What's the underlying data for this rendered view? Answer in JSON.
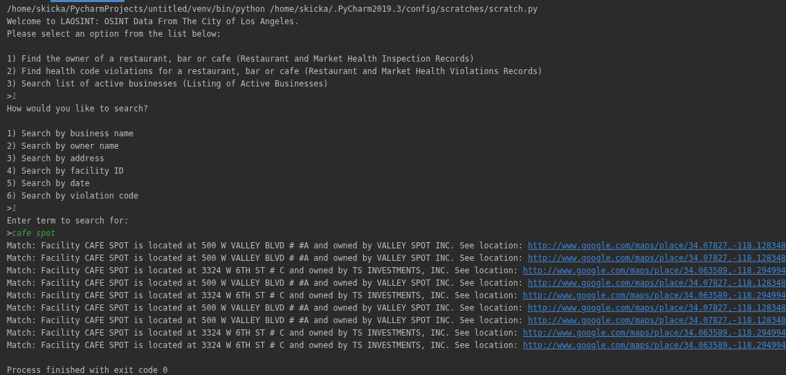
{
  "console": {
    "lines": [
      {
        "kind": "text",
        "text": "/home/skicka/PycharmProjects/untitled/venv/bin/python /home/skicka/.PyCharm2019.3/config/scratches/scratch.py"
      },
      {
        "kind": "text",
        "text": "Welcome to LAOSINT: OSINT Data From The City of Los Angeles."
      },
      {
        "kind": "text",
        "text": "Please select an option from the list below:"
      },
      {
        "kind": "blank"
      },
      {
        "kind": "text",
        "text": "1) Find the owner of a restaurant, bar or cafe (Restaurant and Market Health Inspection Records)"
      },
      {
        "kind": "text",
        "text": "2) Find health code violations for a restaurant, bar or cafe (Restaurant and Market Health Violations Records)"
      },
      {
        "kind": "text",
        "text": "3) Search list of active businesses (Listing of Active Businesses)"
      },
      {
        "kind": "input",
        "prompt": ">",
        "value": "1"
      },
      {
        "kind": "text",
        "text": "How would you like to search?"
      },
      {
        "kind": "blank"
      },
      {
        "kind": "text",
        "text": "1) Search by business name"
      },
      {
        "kind": "text",
        "text": "2) Search by owner name"
      },
      {
        "kind": "text",
        "text": "3) Search by address"
      },
      {
        "kind": "text",
        "text": "4) Search by facility ID"
      },
      {
        "kind": "text",
        "text": "5) Search by date"
      },
      {
        "kind": "text",
        "text": "6) Search by violation code"
      },
      {
        "kind": "input",
        "prompt": ">",
        "value": "1"
      },
      {
        "kind": "text",
        "text": "Enter term to search for:"
      },
      {
        "kind": "input",
        "prompt": ">",
        "value": "cafe spot"
      },
      {
        "kind": "match",
        "text": "Match: Facility CAFE SPOT is located at 500 W VALLEY BLVD # #A and owned by VALLEY SPOT INC. See location:",
        "link": "http://www.google.com/maps/place/34.07827,-118.128348"
      },
      {
        "kind": "match",
        "text": "Match: Facility CAFE SPOT is located at 500 W VALLEY BLVD # #A and owned by VALLEY SPOT INC. See location:",
        "link": "http://www.google.com/maps/place/34.07827,-118.128348"
      },
      {
        "kind": "match",
        "text": "Match: Facility CAFE SPOT is located at 3324 W 6TH ST # C and owned by TS INVESTMENTS, INC. See location:",
        "link": "http://www.google.com/maps/place/34.063589,-118.294994"
      },
      {
        "kind": "match",
        "text": "Match: Facility CAFE SPOT is located at 500 W VALLEY BLVD # #A and owned by VALLEY SPOT INC. See location:",
        "link": "http://www.google.com/maps/place/34.07827,-118.128348"
      },
      {
        "kind": "match",
        "text": "Match: Facility CAFE SPOT is located at 3324 W 6TH ST # C and owned by TS INVESTMENTS, INC. See location:",
        "link": "http://www.google.com/maps/place/34.063589,-118.294994"
      },
      {
        "kind": "match",
        "text": "Match: Facility CAFE SPOT is located at 500 W VALLEY BLVD # #A and owned by VALLEY SPOT INC. See location:",
        "link": "http://www.google.com/maps/place/34.07827,-118.128348"
      },
      {
        "kind": "match",
        "text": "Match: Facility CAFE SPOT is located at 500 W VALLEY BLVD # #A and owned by VALLEY SPOT INC. See location:",
        "link": "http://www.google.com/maps/place/34.07827,-118.128348"
      },
      {
        "kind": "match",
        "text": "Match: Facility CAFE SPOT is located at 3324 W 6TH ST # C and owned by TS INVESTMENTS, INC. See location:",
        "link": "http://www.google.com/maps/place/34.063589,-118.294994"
      },
      {
        "kind": "match",
        "text": "Match: Facility CAFE SPOT is located at 3324 W 6TH ST # C and owned by TS INVESTMENTS, INC. See location:",
        "link": "http://www.google.com/maps/place/34.063589,-118.294994"
      },
      {
        "kind": "blank"
      },
      {
        "kind": "text",
        "text": "Process finished with exit code 0"
      }
    ]
  }
}
